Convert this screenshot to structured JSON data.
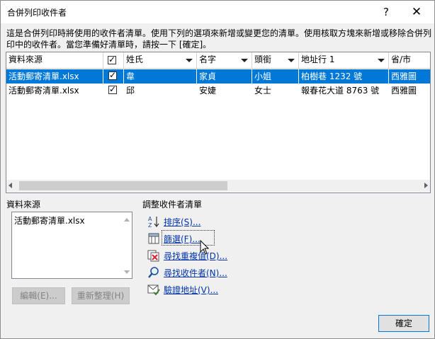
{
  "window": {
    "title": "合併列印收件者",
    "help_glyph": "?",
    "close_glyph": "✕"
  },
  "intro_text": "這是合併列印時將使用的收件者清單。使用下列的選項來新增或變更您的清單。使用核取方塊來新增或移除合併列印中的收件者。當您準備好清單時，請按一下 [確定]。",
  "grid": {
    "columns": [
      {
        "label": "資料來源",
        "has_arrow": false
      },
      {
        "label": "",
        "has_arrow": false,
        "checkbox": true
      },
      {
        "label": "姓氏",
        "has_arrow": true
      },
      {
        "label": "名字",
        "has_arrow": true
      },
      {
        "label": "頭銜",
        "has_arrow": true
      },
      {
        "label": "地址行 1",
        "has_arrow": true
      },
      {
        "label": "省/市",
        "has_arrow": false
      }
    ],
    "rows": [
      {
        "source": "活動郵寄清單.xlsx",
        "checked": true,
        "last": "韋",
        "first": "家貞",
        "title": "小姐",
        "address": "柏樹巷 1232 號",
        "city": "西雅圖",
        "selected": true
      },
      {
        "source": "活動郵寄清單.xlsx",
        "checked": true,
        "last": "邱",
        "first": "安婕",
        "title": "女士",
        "address": "報春花大道 8763 號",
        "city": "西雅圖",
        "selected": false
      }
    ],
    "check_glyph": "✓"
  },
  "data_source": {
    "label": "資料來源",
    "items": [
      "活動郵寄清單.xlsx"
    ],
    "edit_button": "編輯(E)...",
    "refresh_button": "重新整理(H)"
  },
  "refine": {
    "label": "調整收件者清單",
    "links": [
      {
        "label": "排序(S)...",
        "icon": "sort-az-icon"
      },
      {
        "label": "篩選(F)...",
        "icon": "filter-icon"
      },
      {
        "label": "尋找重複值(D)...",
        "icon": "find-duplicates-icon"
      },
      {
        "label": "尋找收件者(N)...",
        "icon": "find-recipient-icon"
      },
      {
        "label": "驗證地址(V)...",
        "icon": "validate-address-icon"
      }
    ]
  },
  "ok_button": "確定",
  "colors": {
    "selection": "#0078d7",
    "link": "#0033aa"
  }
}
